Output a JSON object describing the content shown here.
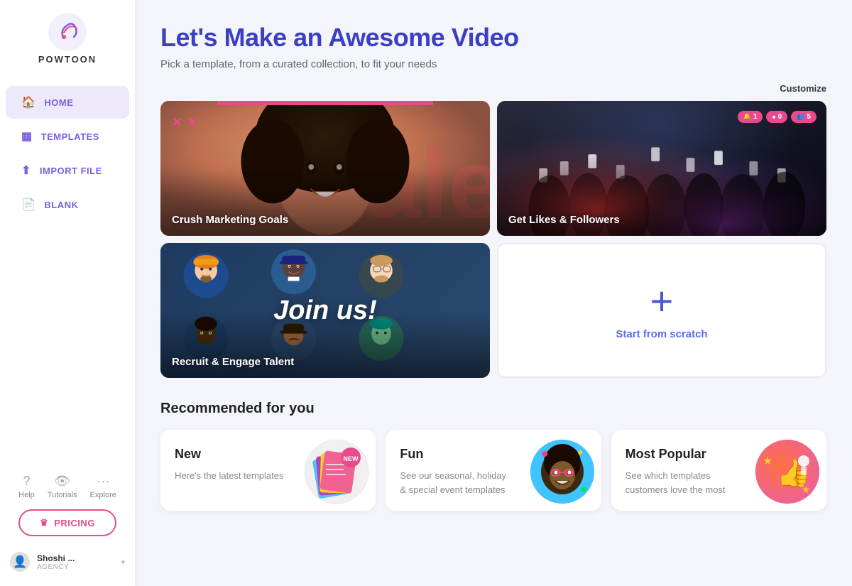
{
  "sidebar": {
    "logo_text": "POWTOON",
    "nav_items": [
      {
        "id": "home",
        "label": "HOME",
        "active": true
      },
      {
        "id": "templates",
        "label": "TEMPLATES",
        "active": false
      },
      {
        "id": "import-file",
        "label": "IMPORT FILE",
        "active": false
      },
      {
        "id": "blank",
        "label": "BLANK",
        "active": false
      }
    ],
    "help_items": [
      {
        "id": "help",
        "label": "Help"
      },
      {
        "id": "tutorials",
        "label": "Tutorials"
      },
      {
        "id": "explore",
        "label": "Explore"
      }
    ],
    "pricing_label": "PRICING",
    "user": {
      "name": "Shoshi ...",
      "role": "AGENCY"
    }
  },
  "main": {
    "page_title": "Let's Make an Awesome Video",
    "page_subtitle": "Pick a template, from a curated collection, to fit your needs",
    "customize_label": "Customize",
    "template_cards": [
      {
        "id": "crush",
        "label": "Crush Marketing Goals"
      },
      {
        "id": "likes",
        "label": "Get Likes & Followers"
      },
      {
        "id": "recruit",
        "label": "Recruit & Engage Talent"
      },
      {
        "id": "scratch",
        "label": "Start from scratch"
      }
    ],
    "social_badges": [
      {
        "icon": "🔔",
        "count": "1"
      },
      {
        "icon": "❤️",
        "count": "0"
      },
      {
        "icon": "👤",
        "count": "5"
      }
    ],
    "join_text": "Join us!",
    "scratch_plus": "+",
    "recommended_title": "Recommended for you",
    "rec_cards": [
      {
        "id": "new",
        "title": "New",
        "desc": "Here's the latest templates"
      },
      {
        "id": "fun",
        "title": "Fun",
        "desc": "See our seasonal, holiday & special event templates"
      },
      {
        "id": "popular",
        "title": "Most Popular",
        "desc": "See which templates customers love the most"
      }
    ]
  },
  "colors": {
    "accent_blue": "#4a56d4",
    "accent_pink": "#e94a8c",
    "sidebar_active_bg": "#ede9fb",
    "nav_color": "#7b5fdf"
  }
}
